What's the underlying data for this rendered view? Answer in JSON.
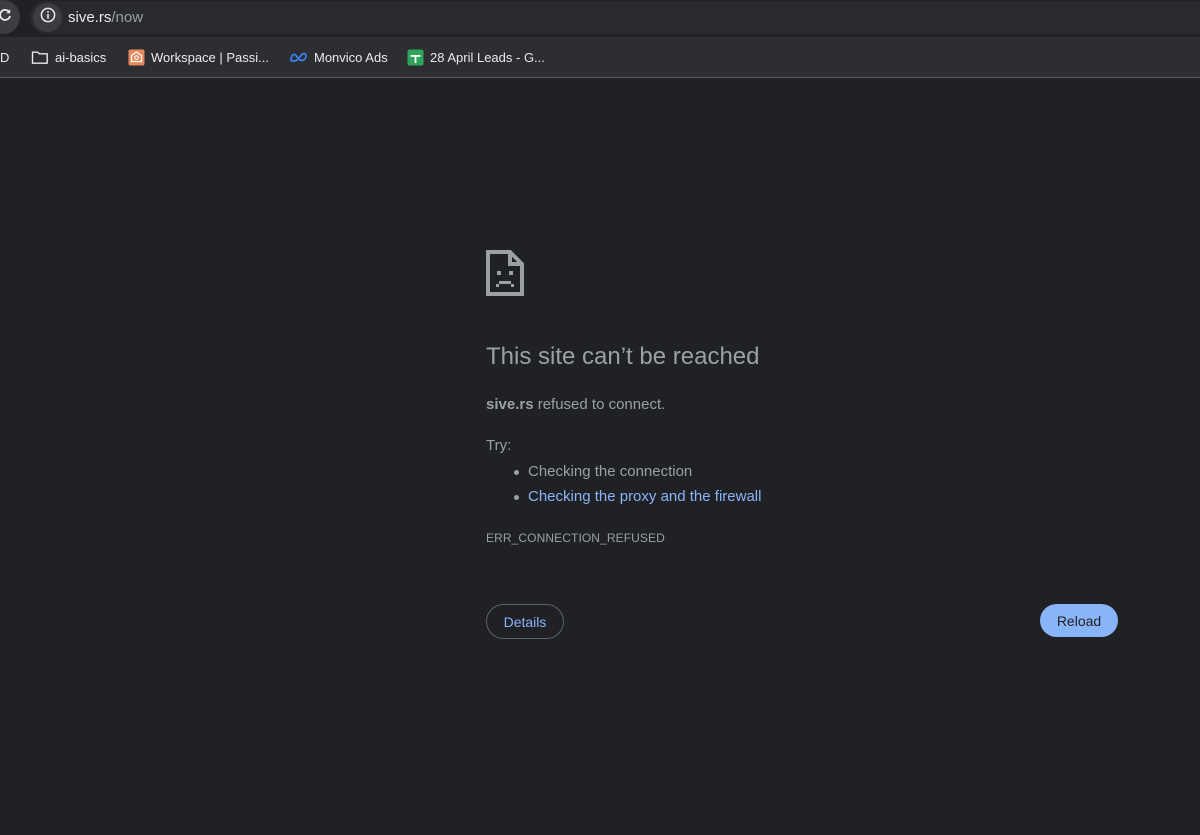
{
  "browser": {
    "address_bar": {
      "host": "sive.rs",
      "path": "/now"
    },
    "bookmarks": [
      {
        "label": "D",
        "icon": "partial-bookmark"
      },
      {
        "label": "ai-basics",
        "icon": "folder-icon"
      },
      {
        "label": "Workspace | Passi...",
        "icon": "workspace-favicon"
      },
      {
        "label": "Monvico Ads",
        "icon": "meta-icon"
      },
      {
        "label": "28 April Leads - G...",
        "icon": "google-sheets-icon"
      }
    ]
  },
  "error_page": {
    "icon": "sad-document-icon",
    "heading": "This site can’t be reached",
    "summary_host": "sive.rs",
    "summary_rest": " refused to connect.",
    "try_label": "Try:",
    "suggestions": [
      "Checking the connection",
      "Checking the proxy and the firewall"
    ],
    "error_code": "ERR_CONNECTION_REFUSED",
    "details_label": "Details",
    "reload_label": "Reload"
  },
  "colors": {
    "page_background": "#202124",
    "text": "#9aa0a6",
    "link": "#8ab4f8",
    "primary_button": "#8ab4f8"
  }
}
